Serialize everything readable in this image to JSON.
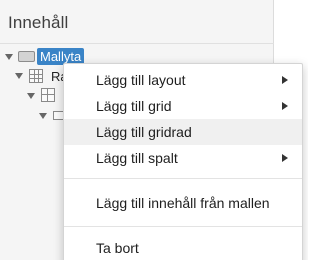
{
  "panel": {
    "title": "Innehåll"
  },
  "tree": [
    {
      "label": "Mallyta",
      "type": "layout",
      "expanded": true,
      "selected": true
    },
    {
      "label": "Ra",
      "type": "grid",
      "expanded": true,
      "selected": false
    },
    {
      "label": "",
      "type": "grid-row",
      "expanded": true,
      "selected": false
    },
    {
      "label": "",
      "type": "column",
      "expanded": true,
      "selected": false
    }
  ],
  "context_menu": {
    "items": [
      {
        "label": "Lägg till layout",
        "has_submenu": true
      },
      {
        "label": "Lägg till grid",
        "has_submenu": true
      },
      {
        "label": "Lägg till gridrad",
        "has_submenu": false,
        "highlighted": true
      },
      {
        "label": "Lägg till spalt",
        "has_submenu": true
      },
      {
        "label": "Lägg till innehåll från mallen",
        "has_submenu": false
      },
      {
        "label": "Ta bort",
        "has_submenu": false
      }
    ]
  },
  "icons": {
    "expand": "triangle-down-icon",
    "submenu": "triangle-right-icon",
    "layout": "layout-icon",
    "grid": "grid-icon",
    "grid_row": "grid-row-icon",
    "column": "column-icon"
  },
  "colors": {
    "selection": "#3a84c7",
    "menu_hover": "#f0f0f0",
    "panel_background": "#f5f5f5"
  }
}
